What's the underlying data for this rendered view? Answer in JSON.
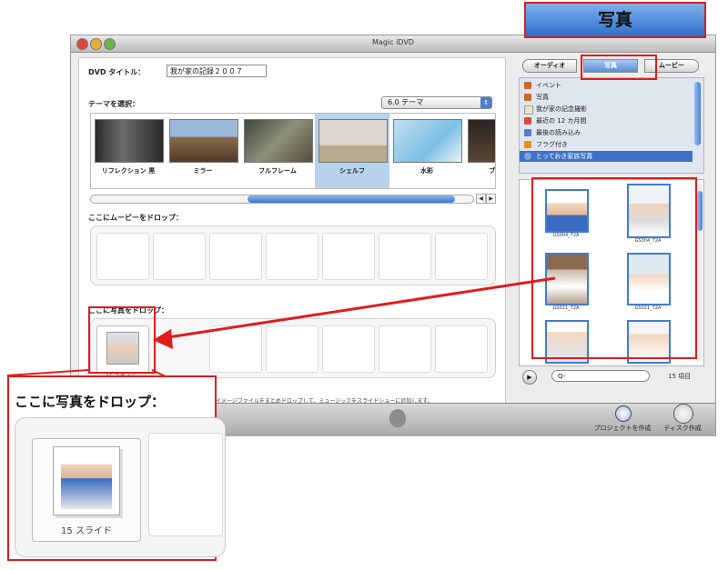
{
  "window": {
    "title": "Magic iDVD"
  },
  "left": {
    "dvd_title_label": "DVD タイトル：",
    "dvd_title_value": "我が家の記録２００７",
    "theme_label": "テーマを選択：",
    "theme_select": "6.0 テーマ",
    "themes": [
      {
        "name": "リフレクション 黒"
      },
      {
        "name": "ミラー"
      },
      {
        "name": "フルフレーム"
      },
      {
        "name": "シェルフ"
      },
      {
        "name": "水彩"
      },
      {
        "name": "ブラシス"
      }
    ],
    "movie_drop_label": "ここにムービーをドロップ：",
    "photo_drop_label": "ここに写真をドロップ：",
    "slide_count": "15 スライド",
    "footer_hint": "イメージファイルをまとめドロップして、ミュージックをスライドショーに追加します。"
  },
  "right": {
    "tabs": [
      "オーディオ",
      "写真",
      "ムービー"
    ],
    "active_tab": 1,
    "sources": [
      {
        "label": "イベント",
        "color": "#c86a2c"
      },
      {
        "label": "写真",
        "color": "#c86a2c"
      },
      {
        "label": "我が家の記念撮影",
        "color": "#e8e8c0"
      },
      {
        "label": "最近の 12 カ月間",
        "color": "#d34b3a"
      },
      {
        "label": "最後の読み込み",
        "color": "#5a7bc4"
      },
      {
        "label": "フラグ付き",
        "color": "#f28b1e"
      },
      {
        "label": "とっておき家族写真",
        "color": "#7fa3d8"
      }
    ],
    "selected_source": 6,
    "photos": [
      "GS004_72A",
      "GS004_72A",
      "GS021_72A",
      "GS021_72A",
      "GS021_72A",
      "GS021_72A"
    ],
    "search_placeholder": "Q-",
    "count": "15 項目"
  },
  "toolbar": {
    "create_project": "プロジェクトを作成",
    "disc_burn": "ディスク作成"
  },
  "callouts": {
    "header": "写真",
    "zoom_label": "ここに写真をドロップ：",
    "zoom_slide_count": "15 スライド"
  },
  "colors": {
    "accent": "#3d72c7",
    "callout": "#e01c1c"
  }
}
